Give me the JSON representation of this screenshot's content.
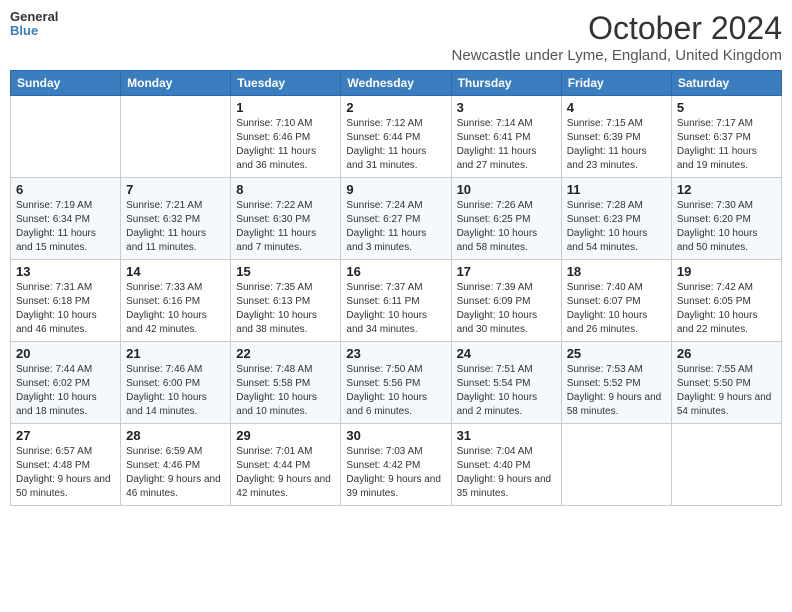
{
  "header": {
    "logo_line1": "General",
    "logo_line2": "Blue",
    "main_title": "October 2024",
    "subtitle": "Newcastle under Lyme, England, United Kingdom"
  },
  "calendar": {
    "days_of_week": [
      "Sunday",
      "Monday",
      "Tuesday",
      "Wednesday",
      "Thursday",
      "Friday",
      "Saturday"
    ],
    "weeks": [
      [
        {
          "day": "",
          "info": ""
        },
        {
          "day": "",
          "info": ""
        },
        {
          "day": "1",
          "info": "Sunrise: 7:10 AM\nSunset: 6:46 PM\nDaylight: 11 hours and 36 minutes."
        },
        {
          "day": "2",
          "info": "Sunrise: 7:12 AM\nSunset: 6:44 PM\nDaylight: 11 hours and 31 minutes."
        },
        {
          "day": "3",
          "info": "Sunrise: 7:14 AM\nSunset: 6:41 PM\nDaylight: 11 hours and 27 minutes."
        },
        {
          "day": "4",
          "info": "Sunrise: 7:15 AM\nSunset: 6:39 PM\nDaylight: 11 hours and 23 minutes."
        },
        {
          "day": "5",
          "info": "Sunrise: 7:17 AM\nSunset: 6:37 PM\nDaylight: 11 hours and 19 minutes."
        }
      ],
      [
        {
          "day": "6",
          "info": "Sunrise: 7:19 AM\nSunset: 6:34 PM\nDaylight: 11 hours and 15 minutes."
        },
        {
          "day": "7",
          "info": "Sunrise: 7:21 AM\nSunset: 6:32 PM\nDaylight: 11 hours and 11 minutes."
        },
        {
          "day": "8",
          "info": "Sunrise: 7:22 AM\nSunset: 6:30 PM\nDaylight: 11 hours and 7 minutes."
        },
        {
          "day": "9",
          "info": "Sunrise: 7:24 AM\nSunset: 6:27 PM\nDaylight: 11 hours and 3 minutes."
        },
        {
          "day": "10",
          "info": "Sunrise: 7:26 AM\nSunset: 6:25 PM\nDaylight: 10 hours and 58 minutes."
        },
        {
          "day": "11",
          "info": "Sunrise: 7:28 AM\nSunset: 6:23 PM\nDaylight: 10 hours and 54 minutes."
        },
        {
          "day": "12",
          "info": "Sunrise: 7:30 AM\nSunset: 6:20 PM\nDaylight: 10 hours and 50 minutes."
        }
      ],
      [
        {
          "day": "13",
          "info": "Sunrise: 7:31 AM\nSunset: 6:18 PM\nDaylight: 10 hours and 46 minutes."
        },
        {
          "day": "14",
          "info": "Sunrise: 7:33 AM\nSunset: 6:16 PM\nDaylight: 10 hours and 42 minutes."
        },
        {
          "day": "15",
          "info": "Sunrise: 7:35 AM\nSunset: 6:13 PM\nDaylight: 10 hours and 38 minutes."
        },
        {
          "day": "16",
          "info": "Sunrise: 7:37 AM\nSunset: 6:11 PM\nDaylight: 10 hours and 34 minutes."
        },
        {
          "day": "17",
          "info": "Sunrise: 7:39 AM\nSunset: 6:09 PM\nDaylight: 10 hours and 30 minutes."
        },
        {
          "day": "18",
          "info": "Sunrise: 7:40 AM\nSunset: 6:07 PM\nDaylight: 10 hours and 26 minutes."
        },
        {
          "day": "19",
          "info": "Sunrise: 7:42 AM\nSunset: 6:05 PM\nDaylight: 10 hours and 22 minutes."
        }
      ],
      [
        {
          "day": "20",
          "info": "Sunrise: 7:44 AM\nSunset: 6:02 PM\nDaylight: 10 hours and 18 minutes."
        },
        {
          "day": "21",
          "info": "Sunrise: 7:46 AM\nSunset: 6:00 PM\nDaylight: 10 hours and 14 minutes."
        },
        {
          "day": "22",
          "info": "Sunrise: 7:48 AM\nSunset: 5:58 PM\nDaylight: 10 hours and 10 minutes."
        },
        {
          "day": "23",
          "info": "Sunrise: 7:50 AM\nSunset: 5:56 PM\nDaylight: 10 hours and 6 minutes."
        },
        {
          "day": "24",
          "info": "Sunrise: 7:51 AM\nSunset: 5:54 PM\nDaylight: 10 hours and 2 minutes."
        },
        {
          "day": "25",
          "info": "Sunrise: 7:53 AM\nSunset: 5:52 PM\nDaylight: 9 hours and 58 minutes."
        },
        {
          "day": "26",
          "info": "Sunrise: 7:55 AM\nSunset: 5:50 PM\nDaylight: 9 hours and 54 minutes."
        }
      ],
      [
        {
          "day": "27",
          "info": "Sunrise: 6:57 AM\nSunset: 4:48 PM\nDaylight: 9 hours and 50 minutes."
        },
        {
          "day": "28",
          "info": "Sunrise: 6:59 AM\nSunset: 4:46 PM\nDaylight: 9 hours and 46 minutes."
        },
        {
          "day": "29",
          "info": "Sunrise: 7:01 AM\nSunset: 4:44 PM\nDaylight: 9 hours and 42 minutes."
        },
        {
          "day": "30",
          "info": "Sunrise: 7:03 AM\nSunset: 4:42 PM\nDaylight: 9 hours and 39 minutes."
        },
        {
          "day": "31",
          "info": "Sunrise: 7:04 AM\nSunset: 4:40 PM\nDaylight: 9 hours and 35 minutes."
        },
        {
          "day": "",
          "info": ""
        },
        {
          "day": "",
          "info": ""
        }
      ]
    ]
  }
}
